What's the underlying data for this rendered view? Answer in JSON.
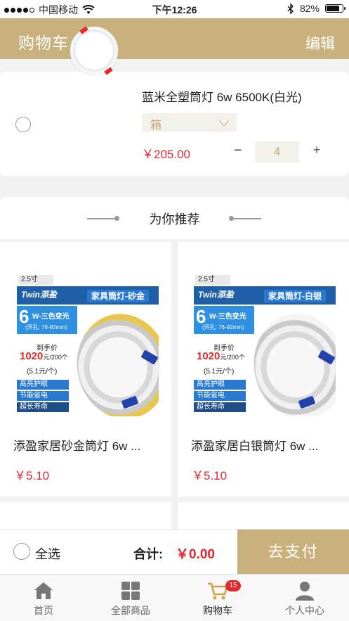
{
  "status_bar": {
    "carrier": "中国移动",
    "time": "下午12:26",
    "battery": "82%",
    "battery_level": 0.82
  },
  "header": {
    "title": "购物车",
    "edit": "编辑"
  },
  "cart_item": {
    "title": "蓝米全塑筒灯 6w 6500K(白光)",
    "spec": "箱",
    "price": "￥205.00",
    "qty_minus": "−",
    "quantity": "4",
    "qty_plus": "+"
  },
  "recommend": {
    "title": "为你推荐",
    "products": [
      {
        "name": "添盈家居砂金筒灯 6w ...",
        "price": "￥5.10",
        "image": {
          "size": "2.5寸",
          "logo": "Twin添盈",
          "tag": "家具筒灯-砂金",
          "power": "6",
          "power_label": "W-三色变光",
          "hole": "(开孔: 76-92mm)",
          "hand": "到手价",
          "price": "1020",
          "price_unit": "元/200个",
          "unit": "(5.1元/个)",
          "b1": "高亮护眼",
          "b2": "节能省电",
          "b3": "超长寿命"
        }
      },
      {
        "name": "添盈家居白银筒灯 6w ...",
        "price": "￥5.10",
        "image": {
          "size": "2.5寸",
          "logo": "Twin添盈",
          "tag": "家具筒灯-白银",
          "power": "6",
          "power_label": "W-三色变光",
          "hole": "(开孔: 76-92mm)",
          "hand": "到手价",
          "price": "1020",
          "price_unit": "元/200个",
          "unit": "(5.1元/个)",
          "b1": "高亮护眼",
          "b2": "节能省电",
          "b3": "超长寿命"
        }
      }
    ]
  },
  "checkout": {
    "select_all": "全选",
    "total_label": "合计:",
    "total_value": "￥0.00",
    "pay": "去支付"
  },
  "tabs": [
    {
      "label": "首页",
      "icon": "home-icon"
    },
    {
      "label": "全部商品",
      "icon": "grid-icon"
    },
    {
      "label": "购物车",
      "icon": "cart-icon",
      "badge": "15"
    },
    {
      "label": "个人中心",
      "icon": "person-icon"
    }
  ],
  "colors": {
    "accent": "#c9b17d",
    "price": "#e5272d",
    "badge": "#e5272d"
  }
}
